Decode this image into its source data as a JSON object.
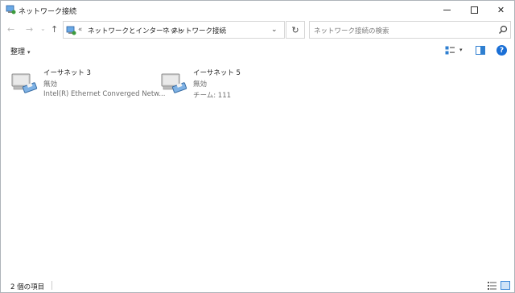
{
  "window": {
    "title": "ネットワーク接続",
    "controls": {
      "minimize": "minimize",
      "maximize": "maximize",
      "close": "✕"
    }
  },
  "address": {
    "more": "«",
    "crumbs": [
      "ネットワークとインターネット",
      "ネットワーク接続"
    ],
    "separator": "›"
  },
  "search": {
    "placeholder": "ネットワーク接続の検索"
  },
  "toolbar": {
    "organize_label": "整理",
    "caret": "▾"
  },
  "items": [
    {
      "name": "イーサネット 3",
      "status": "無効",
      "description": "Intel(R) Ethernet Converged Netw..."
    },
    {
      "name": "イーサネット 5",
      "status": "無効",
      "description": "チーム: 111"
    }
  ],
  "statusbar": {
    "count_text": "2 個の項目"
  },
  "colors": {
    "accent": "#1a6fd6",
    "selected_view": "#cfe3f7"
  },
  "icons": {
    "app": "network-connections-icon",
    "back": "back-arrow-icon",
    "forward": "forward-arrow-icon",
    "up": "up-arrow-icon",
    "refresh": "refresh-icon",
    "search": "search-icon",
    "help": "help-icon",
    "ethernet": "ethernet-adapter-icon"
  }
}
